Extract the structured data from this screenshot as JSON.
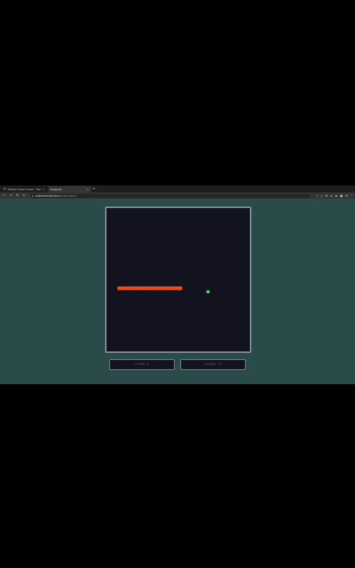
{
  "browser": {
    "tabs": [
      {
        "label": "Editing Snake Game · Markup",
        "active": false
      },
      {
        "label": "Snake.dl",
        "active": true
      }
    ],
    "new_tab_symbol": "+",
    "close_symbol": "×",
    "address": {
      "host": "codeclever.github.io",
      "path": "/snake_game/"
    },
    "nav_icons": [
      "back-icon",
      "forward-icon",
      "reload-icon",
      "home-icon"
    ]
  },
  "game": {
    "board_bg": "#12131f",
    "snake_color": "#f0440c",
    "snake_dot_color": "#ff6a2a",
    "food_color": "#4ade5b",
    "snake_segments": [
      [
        18,
        113
      ],
      [
        22.6,
        113
      ],
      [
        27.2,
        113
      ],
      [
        31.8,
        113
      ],
      [
        36.4,
        113
      ],
      [
        41,
        113
      ],
      [
        45.6,
        113
      ],
      [
        50.2,
        113
      ],
      [
        54.8,
        113
      ],
      [
        59.4,
        113
      ],
      [
        64,
        113
      ],
      [
        68.6,
        113
      ],
      [
        73.2,
        113
      ],
      [
        77.8,
        113
      ],
      [
        82.4,
        113
      ],
      [
        87,
        113
      ],
      [
        91.6,
        113
      ],
      [
        96.2,
        113
      ],
      [
        100.8,
        113
      ],
      [
        104,
        113
      ]
    ],
    "food": [
      143,
      118
    ],
    "level_label": "Level: 4",
    "length_label": "Length: 20"
  }
}
